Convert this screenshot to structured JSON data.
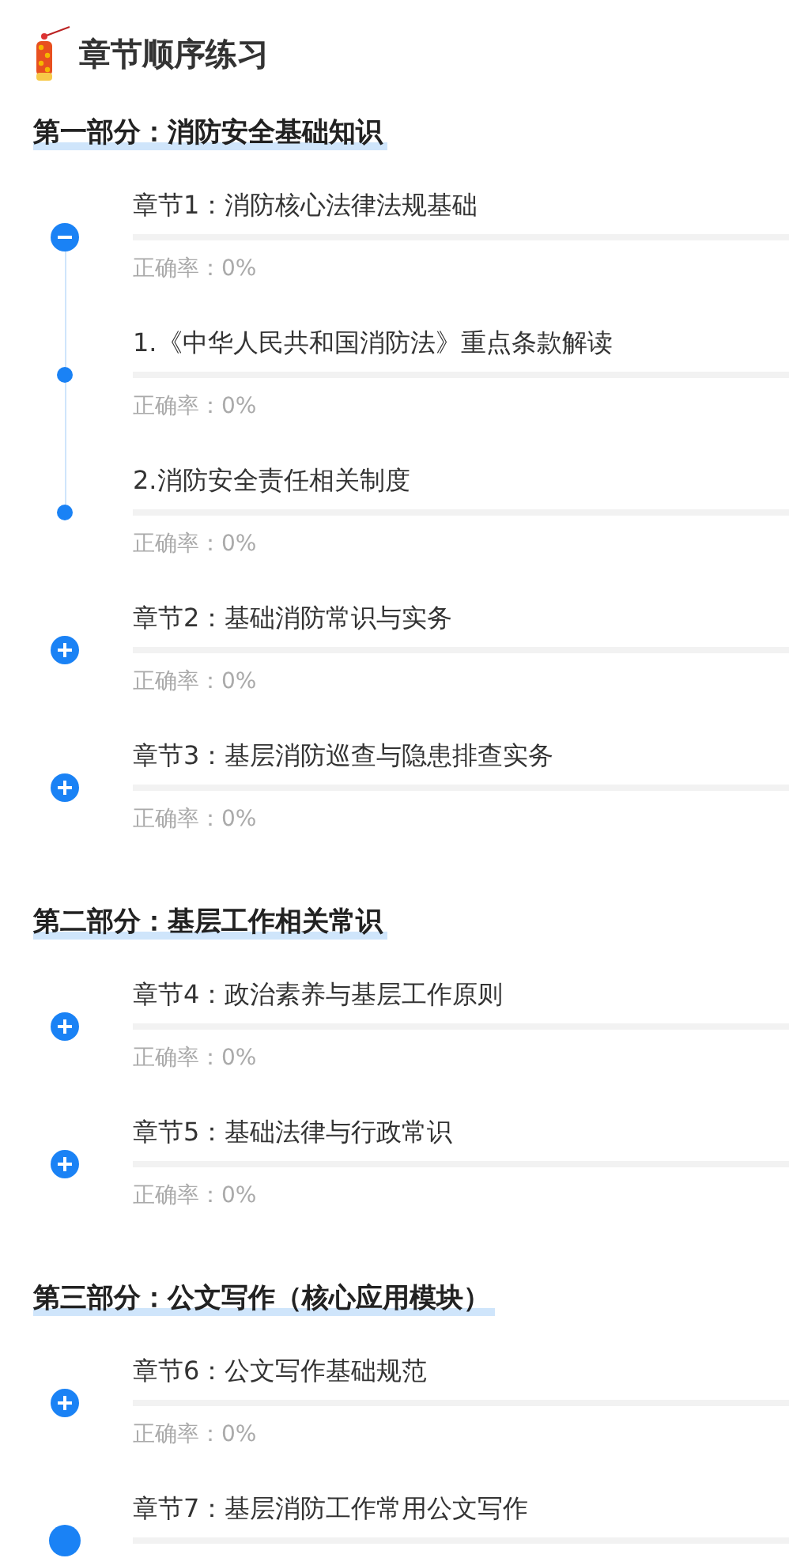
{
  "page_title": "章节顺序练习",
  "parts": [
    {
      "title": "第一部分：消防安全基础知识",
      "chapters": [
        {
          "kind": "group",
          "expanded": true,
          "title": "章节1：消防核心法律法规基础",
          "level": 0,
          "accuracy": "正确率：0%",
          "children": [
            {
              "title": "1.《中华人民共和国消防法》重点条款解读",
              "level": 0,
              "accuracy": "正确率：0%"
            },
            {
              "title": "2.消防安全责任相关制度",
              "level": 0,
              "accuracy": "正确率：0%"
            }
          ]
        },
        {
          "kind": "group",
          "expanded": false,
          "title": "章节2：基础消防常识与实务",
          "level": 0,
          "accuracy": "正确率：0%"
        },
        {
          "kind": "group",
          "expanded": false,
          "title": "章节3：基层消防巡查与隐患排查实务",
          "level": 0,
          "accuracy": "正确率：0%"
        }
      ]
    },
    {
      "title": "第二部分：基层工作相关常识",
      "chapters": [
        {
          "kind": "group",
          "expanded": false,
          "title": "章节4：政治素养与基层工作原则",
          "level": 0,
          "accuracy": "正确率：0%"
        },
        {
          "kind": "group",
          "expanded": false,
          "title": "章节5：基础法律与行政常识",
          "level": 0,
          "accuracy": "正确率：0%"
        }
      ]
    },
    {
      "title": "第三部分：公文写作（核心应用模块）",
      "chapters": [
        {
          "kind": "group",
          "expanded": false,
          "title": "章节6：公文写作基础规范",
          "level": 0,
          "accuracy": "正确率：0%"
        },
        {
          "kind": "single",
          "title": "章节7：基层消防工作常用公文写作",
          "level": 0
        }
      ]
    }
  ]
}
